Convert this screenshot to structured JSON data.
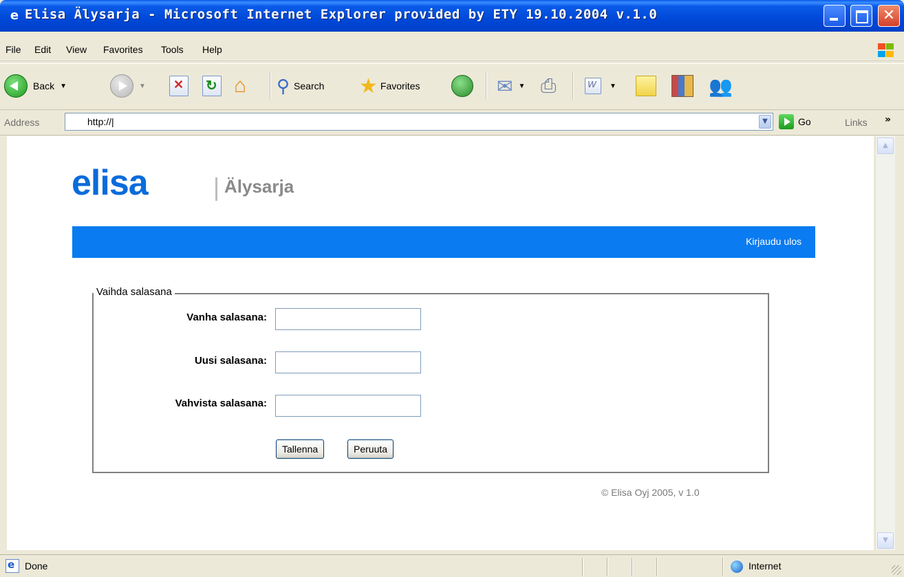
{
  "window": {
    "title": "Elisa Älysarja - Microsoft Internet Explorer provided by ETY 19.10.2004 v.1.0"
  },
  "menu": [
    "File",
    "Edit",
    "View",
    "Favorites",
    "Tools",
    "Help"
  ],
  "toolbar": {
    "back_label": "Back",
    "search_label": "Search",
    "favorites_label": "Favorites"
  },
  "address": {
    "label": "Address",
    "url": "http://|",
    "go_label": "Go",
    "links_label": "Links"
  },
  "page": {
    "logo": "elisa",
    "app_name": "Älysarja",
    "logout_label": "Kirjaudu ulos",
    "form": {
      "legend": "Vaihda salasana",
      "old_password_label": "Vanha salasana:",
      "new_password_label": "Uusi salasana:",
      "confirm_password_label": "Vahvista salasana:",
      "save_label": "Tallenna",
      "cancel_label": "Peruuta"
    },
    "copyright": "© Elisa Oyj 2005, v 1.0"
  },
  "status": {
    "text": "Done",
    "zone": "Internet"
  },
  "colors": {
    "brand_blue": "#0A7BF0",
    "logo_blue": "#0B6BDB",
    "titlebar_blue": "#0A5AE8"
  }
}
